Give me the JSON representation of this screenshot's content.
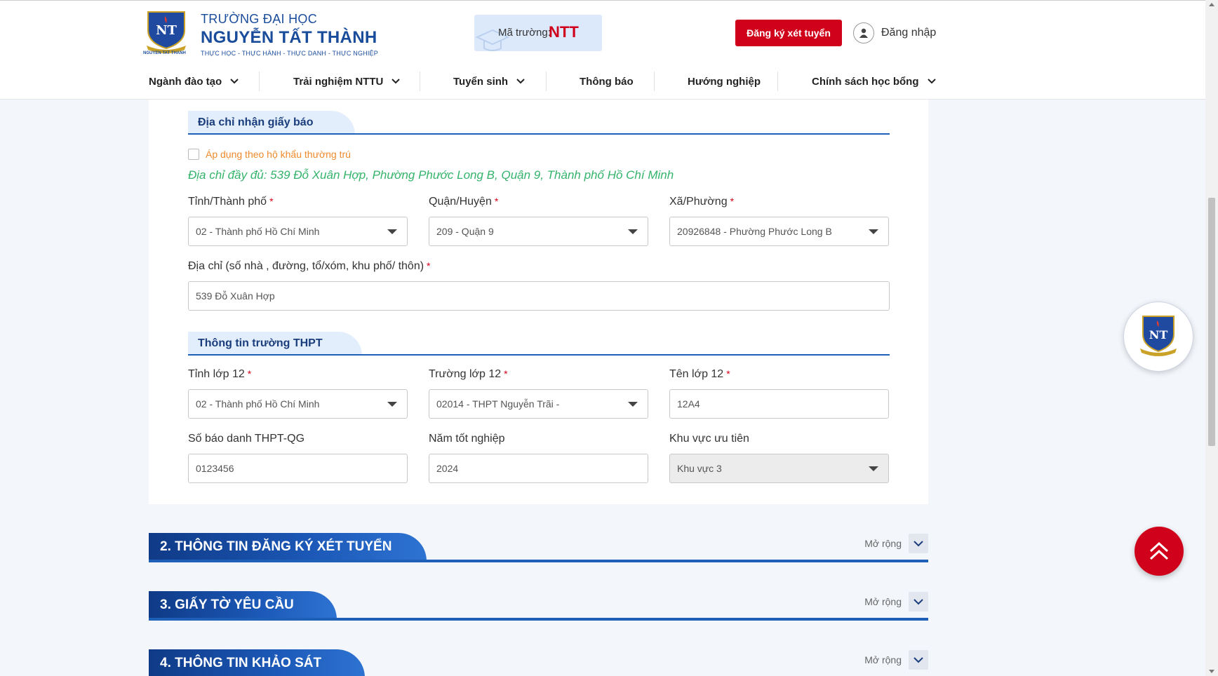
{
  "header": {
    "logo_line1": "TRƯỜNG ĐẠI HỌC",
    "logo_line2": "NGUYỄN TẤT THÀNH",
    "logo_line3": "THỰC HỌC - THỰC HÀNH - THỰC DANH - THỰC NGHIỆP",
    "logo_emblem_text": "NGUYEN TAT THANH",
    "ma_truong_label": "Mã trường:",
    "ma_truong_code": "NTT",
    "register_button": "Đăng ký xét tuyển",
    "login_label": "Đăng nhập"
  },
  "nav": {
    "items": [
      {
        "label": "Ngành đào tạo",
        "has_dropdown": true
      },
      {
        "label": "Trải nghiệm NTTU",
        "has_dropdown": true
      },
      {
        "label": "Tuyển sinh",
        "has_dropdown": true
      },
      {
        "label": "Thông báo",
        "has_dropdown": false
      },
      {
        "label": "Hướng nghiệp",
        "has_dropdown": false
      },
      {
        "label": "Chính sách học bổng",
        "has_dropdown": true
      }
    ]
  },
  "address_section": {
    "title": "Địa chỉ nhận giấy báo",
    "checkbox_label": "Áp dụng theo hộ khẩu thường trú",
    "checkbox_checked": false,
    "full_address": "Địa chỉ đầy đủ: 539 Đỗ Xuân Hợp, Phường Phước Long B, Quận 9, Thành phố Hồ Chí Minh",
    "province_label": "Tỉnh/Thành phố",
    "province_value": "02 - Thành phố Hồ Chí Minh",
    "district_label": "Quận/Huyện",
    "district_value": "209 - Quận 9",
    "ward_label": "Xã/Phường",
    "ward_value": "20926848 - Phường Phước Long B",
    "street_label": "Địa chỉ (số nhà , đường, tổ/xóm, khu phố/ thôn)",
    "street_value": "539 Đỗ Xuân Hợp",
    "required_mark": "*"
  },
  "school_section": {
    "title": "Thông tin trường THPT",
    "grade12_province_label": "Tỉnh lớp 12",
    "grade12_province_value": "02 - Thành phố Hồ Chí Minh",
    "grade12_school_label": "Trường lớp 12",
    "grade12_school_value": "02014 - THPT Nguyễn Trãi -",
    "class_name_label": "Tên lớp 12",
    "class_name_value": "12A4",
    "exam_id_label": "Số báo danh THPT-QG",
    "exam_id_value": "0123456",
    "grad_year_label": "Năm tốt nghiệp",
    "grad_year_value": "2024",
    "priority_area_label": "Khu vực ưu tiên",
    "priority_area_value": "Khu vực 3"
  },
  "accordions": [
    {
      "title": "2. THÔNG TIN ĐĂNG KÝ XÉT TUYỂN",
      "expand_label": "Mở rộng"
    },
    {
      "title": "3. GIẤY TỜ YÊU CẦU",
      "expand_label": "Mở rộng"
    },
    {
      "title": "4. THÔNG TIN KHẢO SÁT",
      "expand_label": "Mở rộng"
    }
  ],
  "colors": {
    "brand_blue": "#1a4c9c",
    "accent_red": "#d0021b",
    "section_blue": "#1e5fb8",
    "address_green": "#34b36b",
    "checkbox_orange": "#ee8a2c"
  },
  "icons": [
    "user-icon",
    "chevron-down-icon",
    "caret-down-icon",
    "arrow-up-icon",
    "graduation-cap-icon"
  ]
}
